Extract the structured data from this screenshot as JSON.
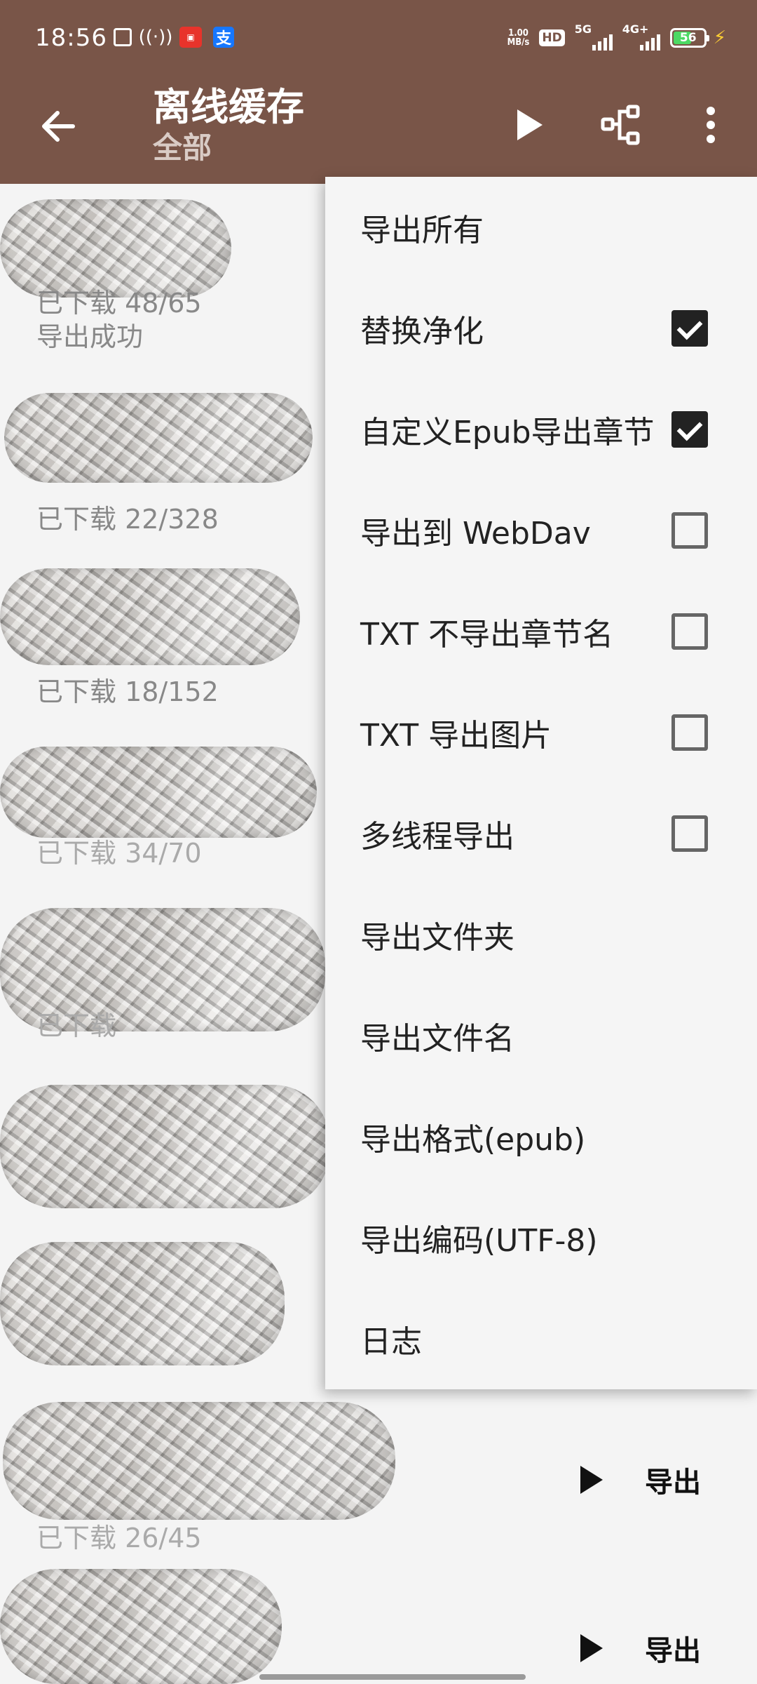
{
  "status_bar": {
    "time": "18:56",
    "left_icons": [
      "cast-icon",
      "hotspot-icon",
      "app-notification-icon",
      "alipay-icon"
    ],
    "alipay_glyph": "支",
    "net_speed": "1.00",
    "net_speed_unit": "MB/s",
    "hd_badge": "HD",
    "signal_1": "5G",
    "signal_2": "4G+",
    "battery": "56",
    "charging": true
  },
  "toolbar": {
    "title": "离线缓存",
    "subtitle": "全部",
    "back_icon": "arrow-left-icon",
    "play_icon": "play-icon",
    "group_icon": "hierarchy-icon",
    "more_icon": "more-vert-icon",
    "background": "#795548"
  },
  "list": {
    "items": [
      {
        "line1": "已下载 48/65",
        "line2": "导出成功"
      },
      {
        "line1": "已下载 22/328"
      },
      {
        "line1": "已下载 18/152"
      },
      {
        "line1": "已下载 34/70"
      },
      {
        "line1": "已下载"
      },
      {
        "line1": ""
      },
      {
        "line1": ""
      },
      {
        "line1": "已下载 26/45",
        "action": "导出"
      },
      {
        "line1": "",
        "action": "导出"
      }
    ]
  },
  "menu": {
    "items": [
      {
        "label": "导出所有"
      },
      {
        "label": "替换净化",
        "checked": true
      },
      {
        "label": "自定义Epub导出章节",
        "checked": true
      },
      {
        "label": "导出到 WebDav",
        "checked": false
      },
      {
        "label": "TXT 不导出章节名",
        "checked": false
      },
      {
        "label": "TXT 导出图片",
        "checked": false
      },
      {
        "label": "多线程导出",
        "checked": false
      },
      {
        "label": "导出文件夹"
      },
      {
        "label": "导出文件名"
      },
      {
        "label": "导出格式(epub)"
      },
      {
        "label": "导出编码(UTF-8)"
      },
      {
        "label": "日志"
      }
    ]
  }
}
